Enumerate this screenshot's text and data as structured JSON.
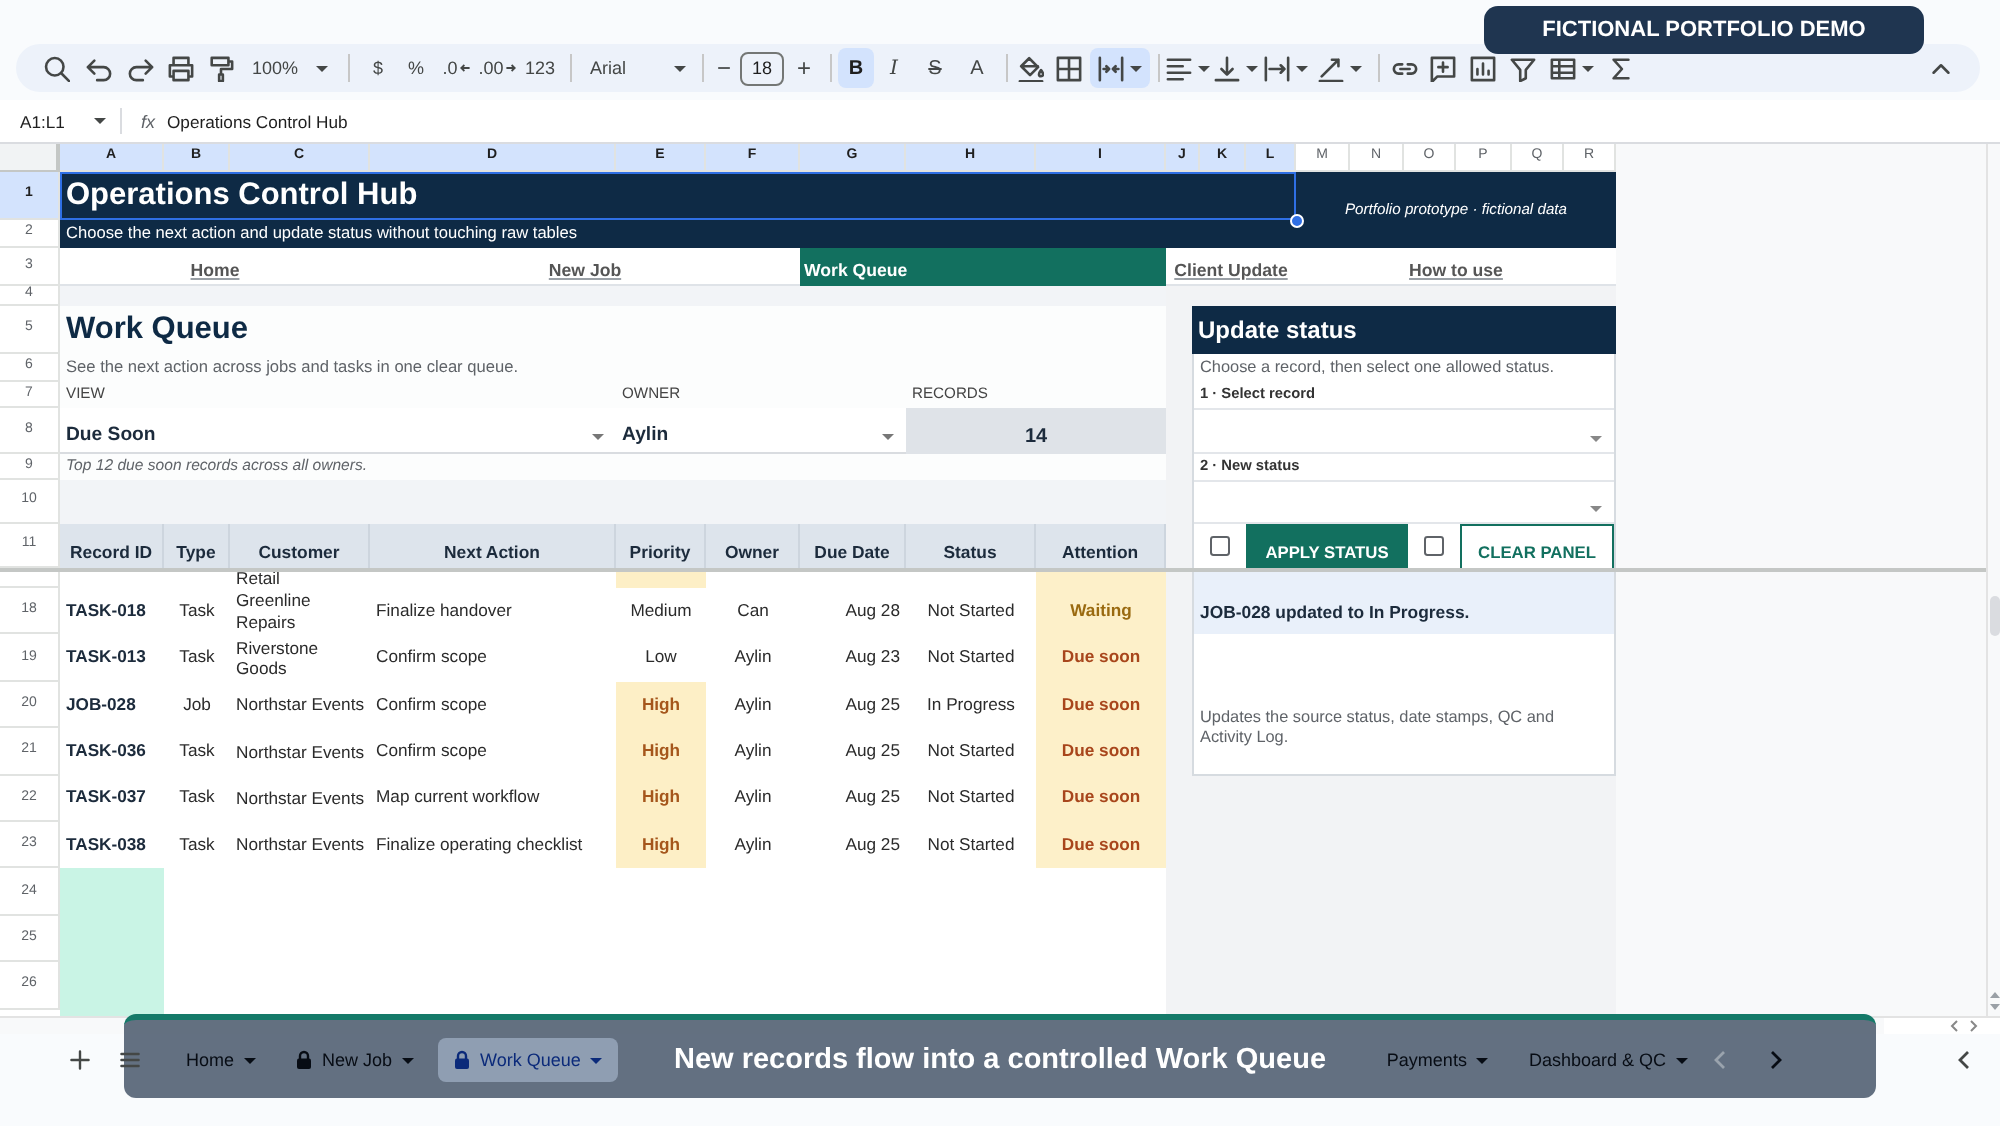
{
  "badge": "FICTIONAL PORTFOLIO DEMO",
  "toolbar": {
    "zoom": "100%",
    "currency": "$",
    "percent": "%",
    "decrease_decimal": ".0",
    "increase_decimal": ".00",
    "number_format": "123",
    "font": "Arial",
    "font_size_minus": "−",
    "font_size": "18",
    "font_size_plus": "+",
    "bold": {
      "label": "B",
      "on": true
    },
    "italic": {
      "label": "I",
      "on": false
    },
    "strikethrough": "S",
    "text_color": "A",
    "merge": {
      "on": true
    }
  },
  "formula_bar": {
    "range": "A1:L1",
    "fx": "fx",
    "formula": "Operations Control Hub"
  },
  "column_headers": [
    {
      "label": "A",
      "selected": true
    },
    {
      "label": "B",
      "selected": true
    },
    {
      "label": "C",
      "selected": true
    },
    {
      "label": "D",
      "selected": true
    },
    {
      "label": "E",
      "selected": true
    },
    {
      "label": "F",
      "selected": true
    },
    {
      "label": "G",
      "selected": true
    },
    {
      "label": "H",
      "selected": true
    },
    {
      "label": "I",
      "selected": true
    },
    {
      "label": "J",
      "selected": true
    },
    {
      "label": "K",
      "selected": true
    },
    {
      "label": "L",
      "selected": true
    },
    {
      "label": "M",
      "selected": false
    },
    {
      "label": "N",
      "selected": false
    },
    {
      "label": "O",
      "selected": false
    },
    {
      "label": "P",
      "selected": false
    },
    {
      "label": "Q",
      "selected": false
    },
    {
      "label": "R",
      "selected": false
    }
  ],
  "row_headers": [
    {
      "label": "1",
      "selected": true
    },
    {
      "label": "2",
      "selected": false
    },
    {
      "label": "3",
      "selected": false
    },
    {
      "label": "4",
      "selected": false
    },
    {
      "label": "5",
      "selected": false
    },
    {
      "label": "6",
      "selected": false
    },
    {
      "label": "7",
      "selected": false
    },
    {
      "label": "8",
      "selected": false
    },
    {
      "label": "9",
      "selected": false
    },
    {
      "label": "10",
      "selected": false
    },
    {
      "label": "11",
      "selected": false
    },
    {
      "label": "18",
      "selected": false
    },
    {
      "label": "19",
      "selected": false
    },
    {
      "label": "20",
      "selected": false
    },
    {
      "label": "21",
      "selected": false
    },
    {
      "label": "22",
      "selected": false
    },
    {
      "label": "23",
      "selected": false
    },
    {
      "label": "24",
      "selected": false
    },
    {
      "label": "25",
      "selected": false
    },
    {
      "label": "26",
      "selected": false
    }
  ],
  "banner": {
    "title": "Operations Control Hub",
    "subtitle": "Choose the next action and update status without touching raw tables",
    "note": "Portfolio prototype · fictional data"
  },
  "nav": [
    {
      "label": "Home",
      "selected": false
    },
    {
      "label": "New Job",
      "selected": false
    },
    {
      "label": "Work Queue",
      "selected": true
    },
    {
      "label": "Client Update",
      "selected": false
    },
    {
      "label": "How to use",
      "selected": false
    }
  ],
  "queue": {
    "title": "Work Queue",
    "description": "See the next action across jobs and tasks in one clear queue.",
    "filters": [
      {
        "label": "VIEW",
        "value": "Due Soon"
      },
      {
        "label": "OWNER",
        "value": "Aylin"
      }
    ],
    "records": {
      "label": "RECORDS",
      "value": "14"
    },
    "hint": "Top 12 due soon records across all owners."
  },
  "table": {
    "columns": [
      "Record ID",
      "Type",
      "Customer",
      "Next Action",
      "Priority",
      "Owner",
      "Due Date",
      "Status",
      "Attention"
    ],
    "partial_row": {
      "customer": "Retail",
      "priority": {
        "kind": "high"
      },
      "attention": {
        "kind": "waiting"
      }
    },
    "rows": [
      {
        "record_id": "TASK-018",
        "type": "Task",
        "customer": "Greenline Repairs",
        "next_action": "Finalize handover",
        "priority": {
          "text": "Medium",
          "kind": "medium"
        },
        "owner": "Can",
        "due_date": "Aug 28",
        "status": "Not Started",
        "attention": {
          "text": "Waiting",
          "kind": "waiting"
        }
      },
      {
        "record_id": "TASK-013",
        "type": "Task",
        "customer": "Riverstone Goods",
        "next_action": "Confirm scope",
        "priority": {
          "text": "Low",
          "kind": "low"
        },
        "owner": "Aylin",
        "due_date": "Aug 23",
        "status": "Not Started",
        "attention": {
          "text": "Due soon",
          "kind": "due_soon"
        }
      },
      {
        "record_id": "JOB-028",
        "type": "Job",
        "customer": "Northstar Events",
        "next_action": "Confirm scope",
        "priority": {
          "text": "High",
          "kind": "high"
        },
        "owner": "Aylin",
        "due_date": "Aug 25",
        "status": "In Progress",
        "attention": {
          "text": "Due soon",
          "kind": "due_soon"
        }
      },
      {
        "record_id": "TASK-036",
        "type": "Task",
        "customer": "Northstar Events",
        "next_action": "Confirm scope",
        "priority": {
          "text": "High",
          "kind": "high"
        },
        "owner": "Aylin",
        "due_date": "Aug 25",
        "status": "Not Started",
        "attention": {
          "text": "Due soon",
          "kind": "due_soon"
        }
      },
      {
        "record_id": "TASK-037",
        "type": "Task",
        "customer": "Northstar Events",
        "next_action": "Map current workflow",
        "priority": {
          "text": "High",
          "kind": "high"
        },
        "owner": "Aylin",
        "due_date": "Aug 25",
        "status": "Not Started",
        "attention": {
          "text": "Due soon",
          "kind": "due_soon"
        }
      },
      {
        "record_id": "TASK-038",
        "type": "Task",
        "customer": "Northstar Events",
        "next_action": "Finalize operating checklist",
        "priority": {
          "text": "High",
          "kind": "high"
        },
        "owner": "Aylin",
        "due_date": "Aug 25",
        "status": "Not Started",
        "attention": {
          "text": "Due soon",
          "kind": "due_soon"
        }
      }
    ]
  },
  "panel": {
    "title": "Update status",
    "description": "Choose a record, then select one allowed status.",
    "fields": [
      {
        "label": "1 · Select record"
      },
      {
        "label": "2 · New status"
      }
    ],
    "actions": [
      {
        "kind": "primary",
        "label": "APPLY STATUS",
        "checked": false
      },
      {
        "kind": "secondary",
        "label": "CLEAR PANEL",
        "checked": false
      }
    ],
    "message": "JOB-028 updated to In Progress.",
    "note": "Updates the source status, date stamps, QC and Activity Log."
  },
  "sheet_tabs": {
    "left": [
      {
        "label": "Home",
        "locked": false,
        "selected": false
      },
      {
        "label": "New Job",
        "locked": true,
        "selected": false
      },
      {
        "label": "Work Queue",
        "locked": true,
        "selected": true
      }
    ],
    "right": [
      {
        "label": "Payments",
        "locked": false,
        "selected": false
      },
      {
        "label": "Dashboard & QC",
        "locked": false,
        "selected": false
      }
    ]
  },
  "caption": "New records flow into a controlled Work Queue"
}
